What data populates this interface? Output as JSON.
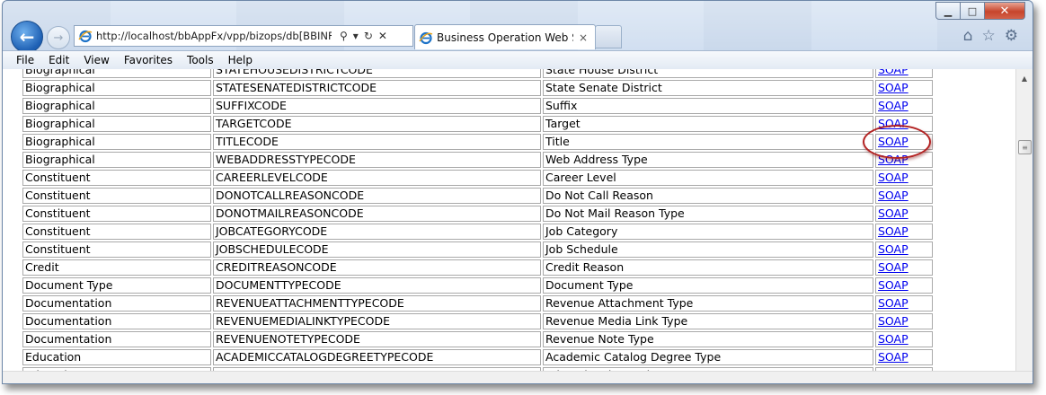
{
  "browser": {
    "address_url": "http://localhost/bbAppFx/vpp/bizops/db[BBINFIN",
    "tab_title": "Business Operation Web Se...",
    "tab_close": "×",
    "window_controls": {
      "minimize": "▁",
      "maximize": "□",
      "close": "✕"
    },
    "right_icons": {
      "home": "⌂",
      "favorites": "☆",
      "tools": "⚙"
    },
    "address_tools": {
      "search": "⚲",
      "dropdown": "▾",
      "refresh": "↻",
      "stop": "✕"
    }
  },
  "menu": {
    "items": [
      "File",
      "Edit",
      "View",
      "Favorites",
      "Tools",
      "Help"
    ]
  },
  "table": {
    "rows": [
      {
        "category": "Biographical",
        "code": "STATEHOUSEDISTRICTCODE",
        "name": "State House District",
        "link": "SOAP"
      },
      {
        "category": "Biographical",
        "code": "STATESENATEDISTRICTCODE",
        "name": "State Senate District",
        "link": "SOAP"
      },
      {
        "category": "Biographical",
        "code": "SUFFIXCODE",
        "name": "Suffix",
        "link": "SOAP"
      },
      {
        "category": "Biographical",
        "code": "TARGETCODE",
        "name": "Target",
        "link": "SOAP"
      },
      {
        "category": "Biographical",
        "code": "TITLECODE",
        "name": "Title",
        "link": "SOAP"
      },
      {
        "category": "Biographical",
        "code": "WEBADDRESSTYPECODE",
        "name": "Web Address Type",
        "link": "SOAP"
      },
      {
        "category": "Constituent",
        "code": "CAREERLEVELCODE",
        "name": "Career Level",
        "link": "SOAP"
      },
      {
        "category": "Constituent",
        "code": "DONOTCALLREASONCODE",
        "name": "Do Not Call Reason",
        "link": "SOAP"
      },
      {
        "category": "Constituent",
        "code": "DONOTMAILREASONCODE",
        "name": "Do Not Mail Reason Type",
        "link": "SOAP"
      },
      {
        "category": "Constituent",
        "code": "JOBCATEGORYCODE",
        "name": "Job Category",
        "link": "SOAP"
      },
      {
        "category": "Constituent",
        "code": "JOBSCHEDULECODE",
        "name": "Job Schedule",
        "link": "SOAP"
      },
      {
        "category": "Credit",
        "code": "CREDITREASONCODE",
        "name": "Credit Reason",
        "link": "SOAP"
      },
      {
        "category": "Document Type",
        "code": "DOCUMENTTYPECODE",
        "name": "Document Type",
        "link": "SOAP"
      },
      {
        "category": "Documentation",
        "code": "REVENUEATTACHMENTTYPECODE",
        "name": "Revenue Attachment Type",
        "link": "SOAP"
      },
      {
        "category": "Documentation",
        "code": "REVENUEMEDIALINKTYPECODE",
        "name": "Revenue Media Link Type",
        "link": "SOAP"
      },
      {
        "category": "Documentation",
        "code": "REVENUENOTETYPECODE",
        "name": "Revenue Note Type",
        "link": "SOAP"
      },
      {
        "category": "Education",
        "code": "ACADEMICCATALOGDEGREETYPECODE",
        "name": "Academic Catalog Degree Type",
        "link": "SOAP"
      },
      {
        "category": "Education",
        "code": "EDUCATIONALAWARDCODE",
        "name": "Educational Award",
        "link": "SOAP"
      }
    ]
  },
  "scrollbar": {
    "up": "▲",
    "thumb_grip": "≡"
  }
}
